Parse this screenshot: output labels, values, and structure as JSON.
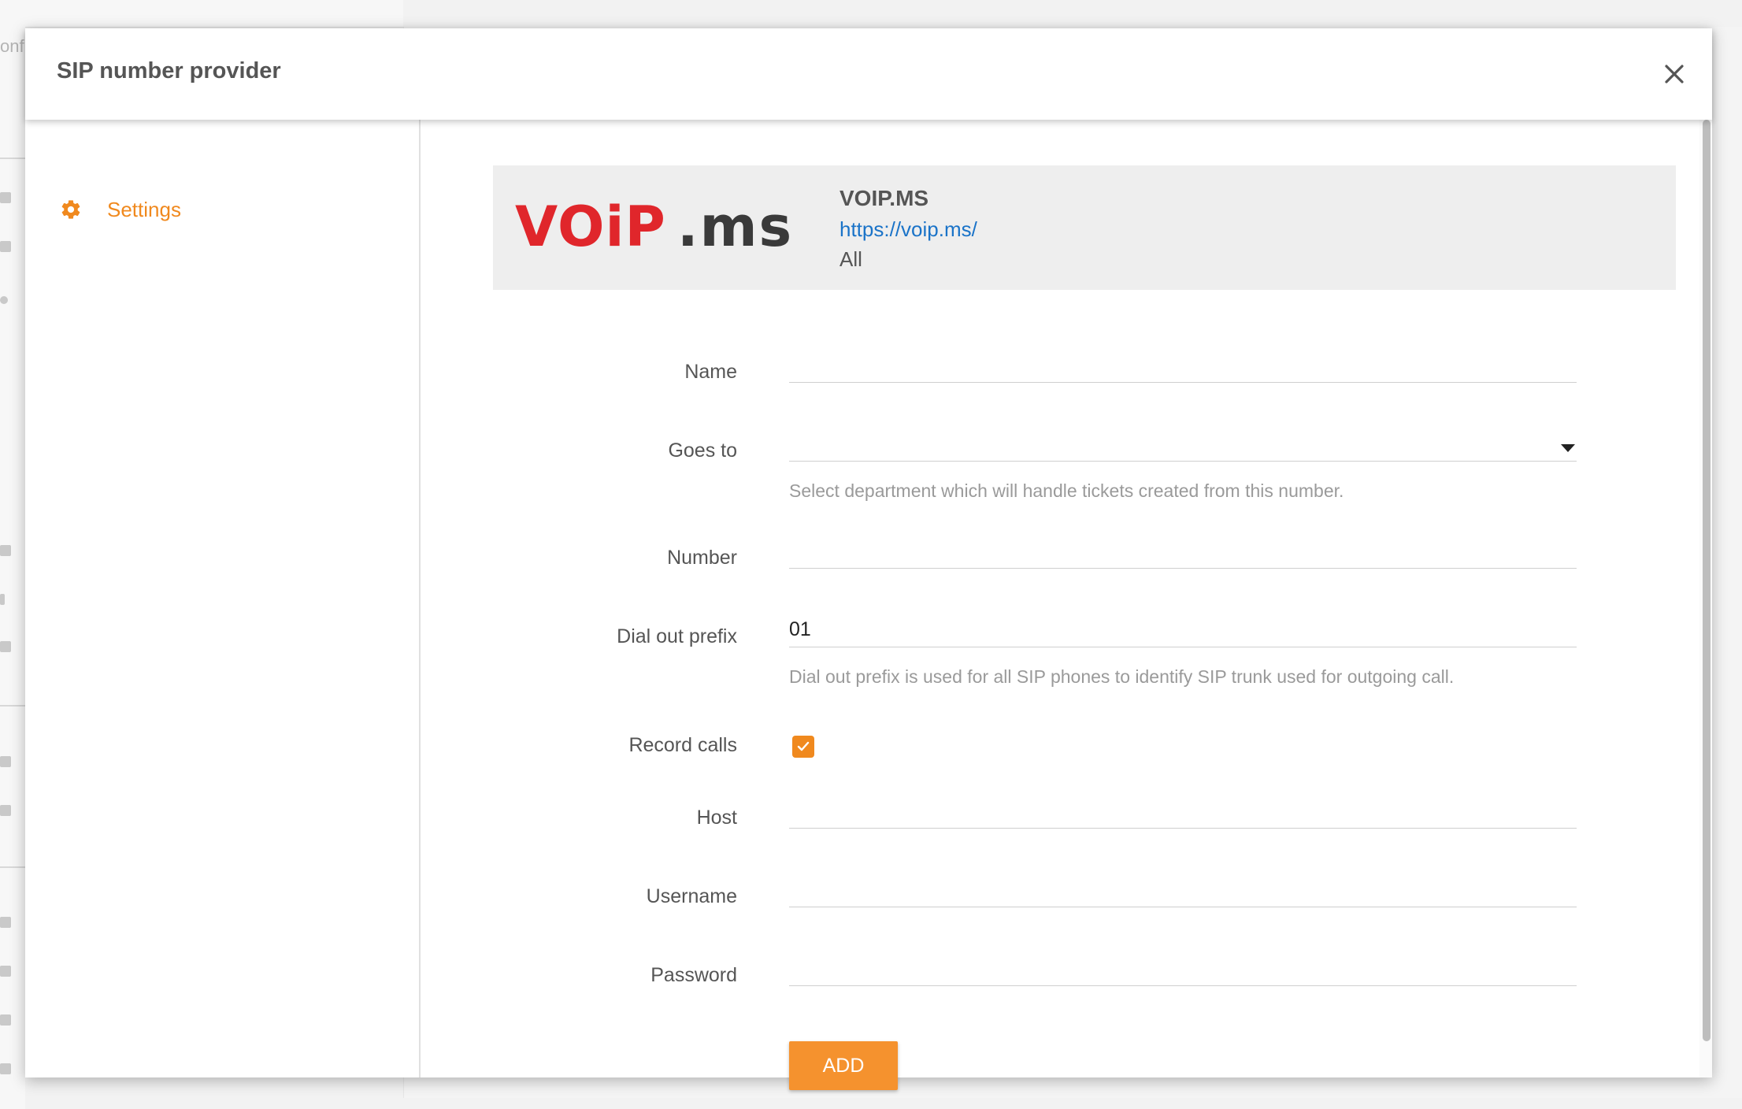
{
  "background": {
    "fragment_text": "onfi"
  },
  "dialog": {
    "title": "SIP number provider"
  },
  "sidebar": {
    "items": [
      {
        "label": "Settings",
        "icon": "gear-icon",
        "active": true
      }
    ]
  },
  "provider": {
    "logo_text_red": "VOiP",
    "logo_text_dark": ".ms",
    "name": "VOIP.MS",
    "url": "https://voip.ms/",
    "region": "All"
  },
  "form": {
    "name": {
      "label": "Name",
      "value": ""
    },
    "goes_to": {
      "label": "Goes to",
      "value": "",
      "hint": "Select department which will handle tickets created from this number."
    },
    "number": {
      "label": "Number",
      "value": ""
    },
    "dial_out_prefix": {
      "label": "Dial out prefix",
      "value": "01",
      "hint": "Dial out prefix is used for all SIP phones to identify SIP trunk used for outgoing call."
    },
    "record_calls": {
      "label": "Record calls",
      "checked": true
    },
    "host": {
      "label": "Host",
      "value": ""
    },
    "username": {
      "label": "Username",
      "value": ""
    },
    "password": {
      "label": "Password",
      "value": ""
    },
    "submit_label": "ADD"
  },
  "colors": {
    "accent": "#f0891e",
    "button": "#f5922e",
    "link": "#1a73c8",
    "logo_red": "#e0262b",
    "logo_dark": "#3a3a3a"
  }
}
